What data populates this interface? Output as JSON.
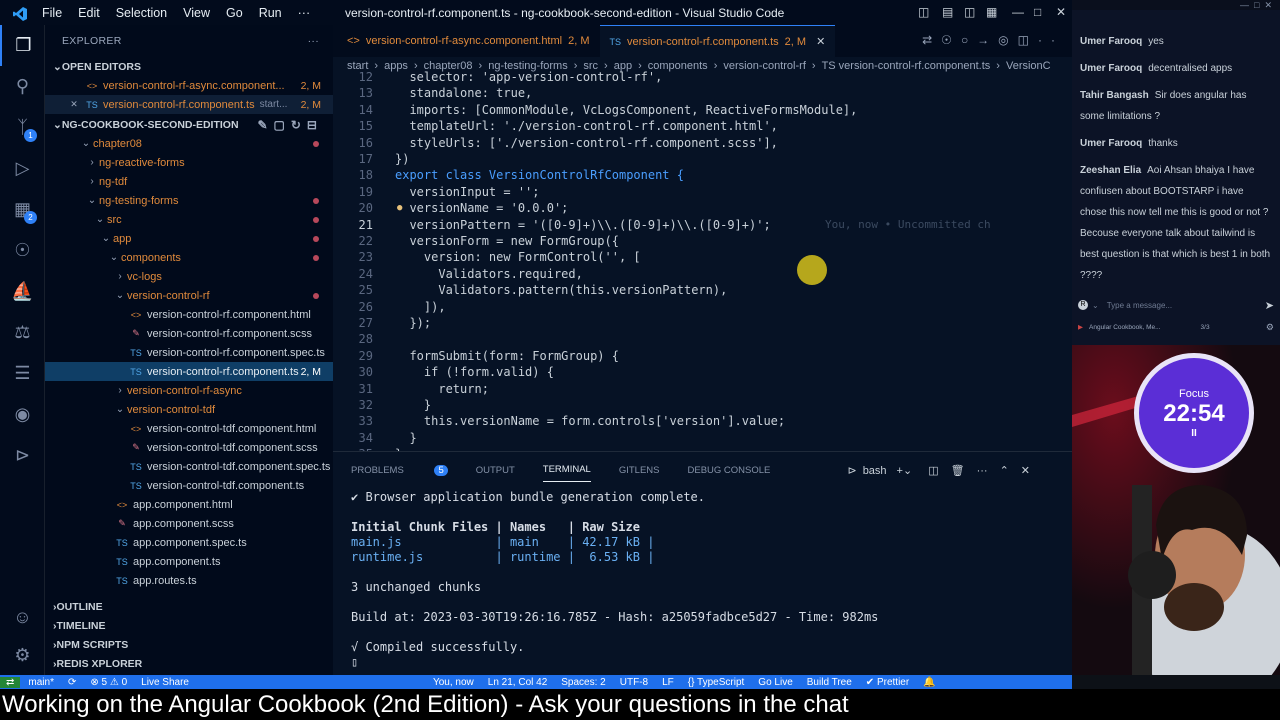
{
  "titlebar": {
    "menu": [
      "File",
      "Edit",
      "Selection",
      "View",
      "Go",
      "Run",
      "···"
    ],
    "title": "version-control-rf.component.ts - ng-cookbook-second-edition - Visual Studio Code"
  },
  "explorer": {
    "header": "EXPLORER",
    "open_editors_label": "OPEN EDITORS",
    "open_editors": [
      {
        "name": "version-control-rf-async.component...",
        "status": "2, M"
      },
      {
        "name": "version-control-rf.component.ts",
        "extra": "start...",
        "status": "2, M"
      }
    ],
    "project_label": "NG-COOKBOOK-SECOND-EDITION",
    "tree": [
      {
        "label": "chapter08",
        "kind": "folder"
      },
      {
        "label": "ng-reactive-forms",
        "kind": "folder"
      },
      {
        "label": "ng-tdf",
        "kind": "folder"
      },
      {
        "label": "ng-testing-forms",
        "kind": "folder"
      },
      {
        "label": "src",
        "kind": "folder"
      },
      {
        "label": "app",
        "kind": "folder"
      },
      {
        "label": "components",
        "kind": "folder"
      },
      {
        "label": "vc-logs",
        "kind": "folder"
      },
      {
        "label": "version-control-rf",
        "kind": "folder"
      },
      {
        "label": "version-control-rf.component.html",
        "icon": "<>"
      },
      {
        "label": "version-control-rf.component.scss",
        "icon": "✎"
      },
      {
        "label": "version-control-rf.component.spec.ts",
        "icon": "TS"
      },
      {
        "label": "version-control-rf.component.ts",
        "icon": "TS",
        "status": "2, M"
      },
      {
        "label": "version-control-rf-async",
        "kind": "folder"
      },
      {
        "label": "version-control-tdf",
        "kind": "folder"
      },
      {
        "label": "version-control-tdf.component.html",
        "icon": "<>"
      },
      {
        "label": "version-control-tdf.component.scss",
        "icon": "✎"
      },
      {
        "label": "version-control-tdf.component.spec.ts",
        "icon": "TS"
      },
      {
        "label": "version-control-tdf.component.ts",
        "icon": "TS"
      },
      {
        "label": "app.component.html",
        "icon": "<>"
      },
      {
        "label": "app.component.scss",
        "icon": "✎"
      },
      {
        "label": "app.component.spec.ts",
        "icon": "TS"
      },
      {
        "label": "app.component.ts",
        "icon": "TS"
      },
      {
        "label": "app.routes.ts",
        "icon": "TS"
      }
    ],
    "sections": [
      "OUTLINE",
      "TIMELINE",
      "NPM SCRIPTS",
      "REDIS XPLORER"
    ]
  },
  "tabs": [
    {
      "icon": "<>",
      "name": "version-control-rf-async.component.html",
      "status": "2, M"
    },
    {
      "icon": "TS",
      "name": "version-control-rf.component.ts",
      "status": "2, M"
    }
  ],
  "breadcrumb": [
    "start",
    "apps",
    "chapter08",
    "ng-testing-forms",
    "src",
    "app",
    "components",
    "version-control-rf",
    "TS version-control-rf.component.ts",
    "VersionC"
  ],
  "code": [
    {
      "n": "12",
      "t": "  selector: 'app-version-control-rf',"
    },
    {
      "n": "13",
      "t": "  standalone: true,"
    },
    {
      "n": "14",
      "t": "  imports: [CommonModule, VcLogsComponent, ReactiveFormsModule],"
    },
    {
      "n": "15",
      "t": "  templateUrl: './version-control-rf.component.html',"
    },
    {
      "n": "16",
      "t": "  styleUrls: ['./version-control-rf.component.scss'],"
    },
    {
      "n": "17",
      "t": "})"
    },
    {
      "n": "18",
      "t": "export class VersionControlRfComponent {"
    },
    {
      "n": "19",
      "t": "  versionInput = '';"
    },
    {
      "n": "20",
      "t": "  versionName = '0.0.0';"
    },
    {
      "n": "21",
      "t": "  versionPattern = '([0-9]+)\\\\.([0-9]+)\\\\.([0-9]+)';"
    },
    {
      "n": "22",
      "t": "  versionForm = new FormGroup({"
    },
    {
      "n": "23",
      "t": "    version: new FormControl('', ["
    },
    {
      "n": "24",
      "t": "      Validators.required,"
    },
    {
      "n": "25",
      "t": "      Validators.pattern(this.versionPattern),"
    },
    {
      "n": "26",
      "t": "    ]),"
    },
    {
      "n": "27",
      "t": "  });"
    },
    {
      "n": "28",
      "t": ""
    },
    {
      "n": "29",
      "t": "  formSubmit(form: FormGroup) {"
    },
    {
      "n": "30",
      "t": "    if (!form.valid) {"
    },
    {
      "n": "31",
      "t": "      return;"
    },
    {
      "n": "32",
      "t": "    }"
    },
    {
      "n": "33",
      "t": "    this.versionName = form.controls['version'].value;"
    },
    {
      "n": "34",
      "t": "  }"
    },
    {
      "n": "35",
      "t": "}"
    }
  ],
  "inline_blame": "You, now • Uncommitted ch",
  "panel": {
    "tabs": [
      "PROBLEMS",
      "OUTPUT",
      "TERMINAL",
      "GITLENS",
      "DEBUG CONSOLE"
    ],
    "problems_count": "5",
    "active_tab": "TERMINAL",
    "shell": "bash",
    "terminal": [
      "✔ Browser application bundle generation complete.",
      "",
      "Initial Chunk Files | Names   | Raw Size",
      "main.js             | main    | 42.17 kB |",
      "runtime.js          | runtime |  6.53 kB |",
      "",
      "3 unchanged chunks",
      "",
      "Build at: 2023-03-30T19:26:16.785Z - Hash: a25059fadbce5d27 - Time: 982ms",
      "",
      "√ Compiled successfully.",
      "▯"
    ]
  },
  "statusbar": {
    "items_left": [
      "main*",
      "⟳",
      "⊗ 5 ⚠ 0",
      "Live Share"
    ],
    "items_right": [
      "You, now",
      "Ln 21, Col 42",
      "Spaces: 2",
      "UTF-8",
      "LF",
      "{} TypeScript",
      "Go Live",
      "Build Tree",
      "✔ Prettier"
    ]
  },
  "chat": {
    "messages": [
      {
        "user": "Umer Farooq",
        "text": "yes"
      },
      {
        "user": "Umer Farooq",
        "text": "decentralised apps"
      },
      {
        "user": "Tahir Bangash",
        "text": "Sir does angular has some limitations ?"
      },
      {
        "user": "Umer Farooq",
        "text": "thanks"
      },
      {
        "user": "Zeeshan Elia",
        "text": "Aoi Ahsan bhaiya I have confiusen about BOOTSTARP i have chose this now tell me this is good or not ? Becouse everyone talk about tailwind is best question is that which is best 1 in both ????"
      }
    ],
    "input_placeholder": "Type a message...",
    "footer": "Angular Cookbook, Me...",
    "footer_count": "3/3"
  },
  "timer": {
    "label": "Focus",
    "time": "22:54",
    "pause": "II"
  },
  "caption": "Working on the Angular Cookbook (2nd Edition) - Ask your questions in the chat",
  "colors": {
    "accent": "#1f6feb",
    "modified": "#e08a3c",
    "timer": "#5b2ed6"
  }
}
